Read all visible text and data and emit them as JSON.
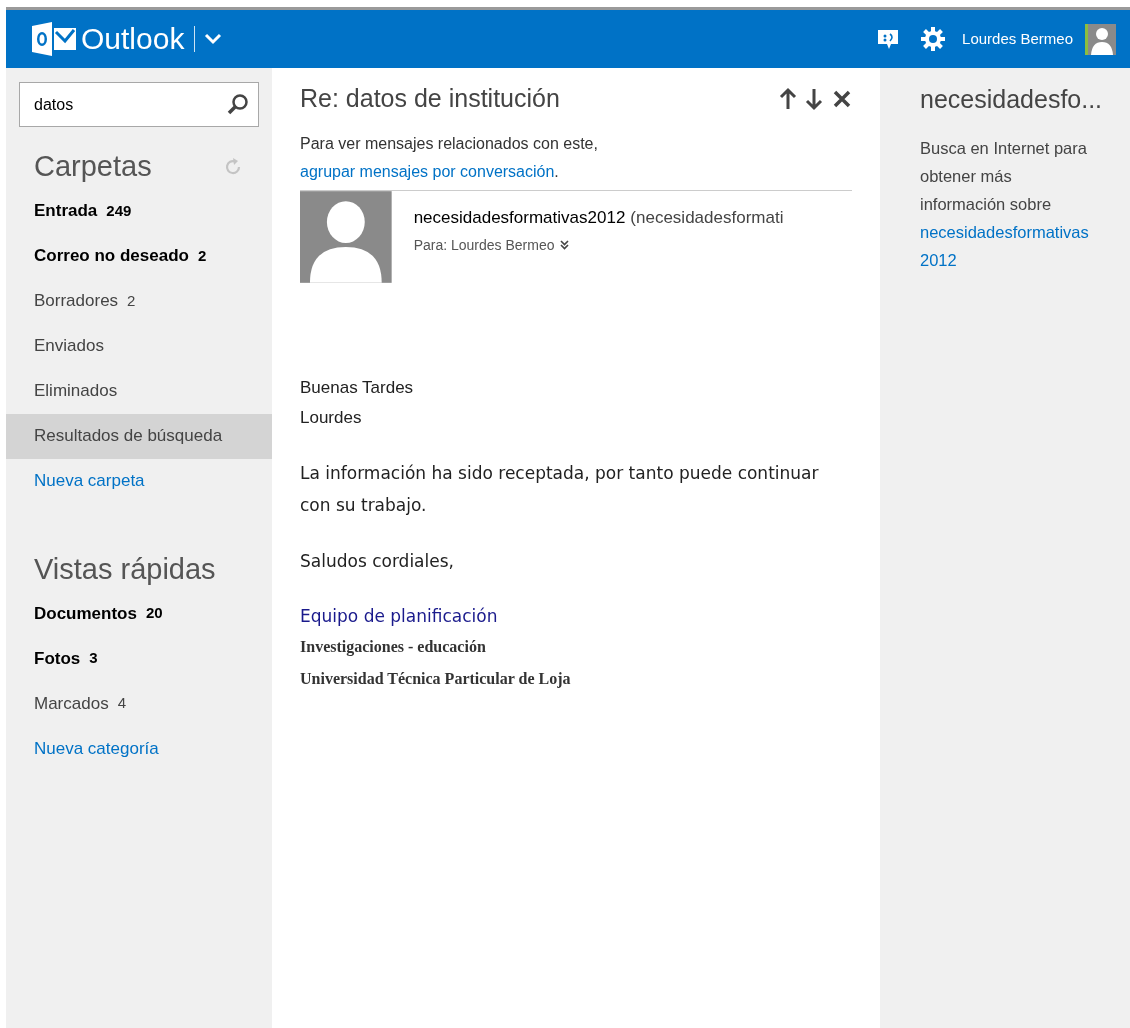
{
  "header": {
    "app_name": "Outlook",
    "user_name": "Lourdes Bermeo"
  },
  "search": {
    "value": "datos"
  },
  "folders": {
    "title": "Carpetas",
    "items": [
      {
        "kind": "folder",
        "label": "Entrada",
        "count": "249",
        "unread": true,
        "selected": false
      },
      {
        "kind": "folder",
        "label": "Correo no deseado",
        "count": "2",
        "unread": true,
        "selected": false
      },
      {
        "kind": "folder",
        "label": "Borradores",
        "count": "2",
        "unread": false,
        "selected": false
      },
      {
        "kind": "folder",
        "label": "Enviados",
        "unread": false,
        "selected": false
      },
      {
        "kind": "folder",
        "label": "Eliminados",
        "unread": false,
        "selected": false
      },
      {
        "kind": "folder",
        "label": "Resultados de búsqueda",
        "unread": false,
        "selected": true
      },
      {
        "kind": "link",
        "label": "Nueva carpeta"
      }
    ]
  },
  "quick_views": {
    "title": "Vistas rápidas",
    "items": [
      {
        "kind": "folder",
        "label": "Documentos",
        "count": "20",
        "unread": true,
        "selected": false
      },
      {
        "kind": "folder",
        "label": "Fotos",
        "count": "3",
        "unread": true,
        "selected": false
      },
      {
        "kind": "folder",
        "label": "Marcados",
        "count": "4",
        "unread": false,
        "selected": false
      },
      {
        "kind": "link",
        "label": "Nueva categoría"
      }
    ]
  },
  "message": {
    "subject": "Re: datos de institución",
    "notice": "Para ver mensajes relacionados con este,",
    "notice_link": "agrupar mensajes por conversación",
    "notice_end": ".",
    "sender": "necesidadesformativas2012",
    "sender_address": "(necesidadesformati",
    "recipient": "Para: Lourdes Bermeo",
    "body": [
      {
        "kind": "plain",
        "lines": [
          "Buenas Tardes",
          "Lourdes"
        ]
      },
      {
        "kind": "comic",
        "lines": [
          "La información ha sido receptada, por tanto puede continuar con su trabajo."
        ]
      },
      {
        "kind": "comic",
        "lines": [
          "Saludos cordiales,"
        ]
      },
      {
        "kind": "signature",
        "lines": [
          "Equipo de planificación",
          "Investigaciones - educación",
          "Universidad Técnica Particular de Loja"
        ]
      }
    ]
  },
  "side_panel": {
    "title": "necesidadesfo...",
    "text": "Busca en Internet para obtener más información sobre",
    "link": "necesidadesformativas2012"
  }
}
